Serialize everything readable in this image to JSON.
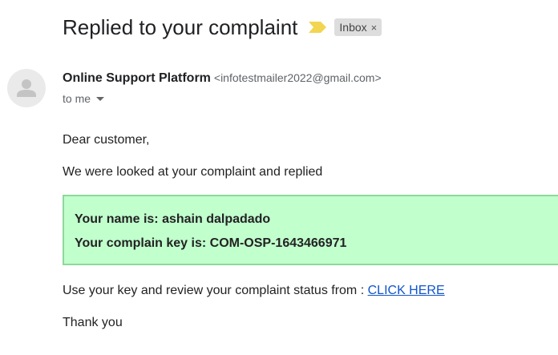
{
  "email": {
    "subject": "Replied to your complaint",
    "label": "Inbox",
    "label_close": "×",
    "sender_name": "Online Support Platform",
    "sender_email": "<infotestmailer2022@gmail.com>",
    "recipient": "to me",
    "greeting": "Dear customer,",
    "intro": "We were looked at your complaint and replied",
    "info_box": {
      "name_line": "Your name is: ashain dalpadado",
      "key_line": "Your complain key is: COM-OSP-1643466971"
    },
    "review_text": "Use your key and review your complaint status from :",
    "review_link": "CLICK HERE",
    "closing": "Thank you"
  },
  "icons": {
    "importance": "importance-marker-icon",
    "avatar": "default-avatar-icon",
    "recipient_details": "chevron-down-icon"
  },
  "colors": {
    "importance_marker": "#f2d550",
    "info_box_background": "#c1ffcd",
    "info_box_border": "#8ed89b",
    "link": "#1155cc",
    "label_chip": "#dddddd"
  }
}
